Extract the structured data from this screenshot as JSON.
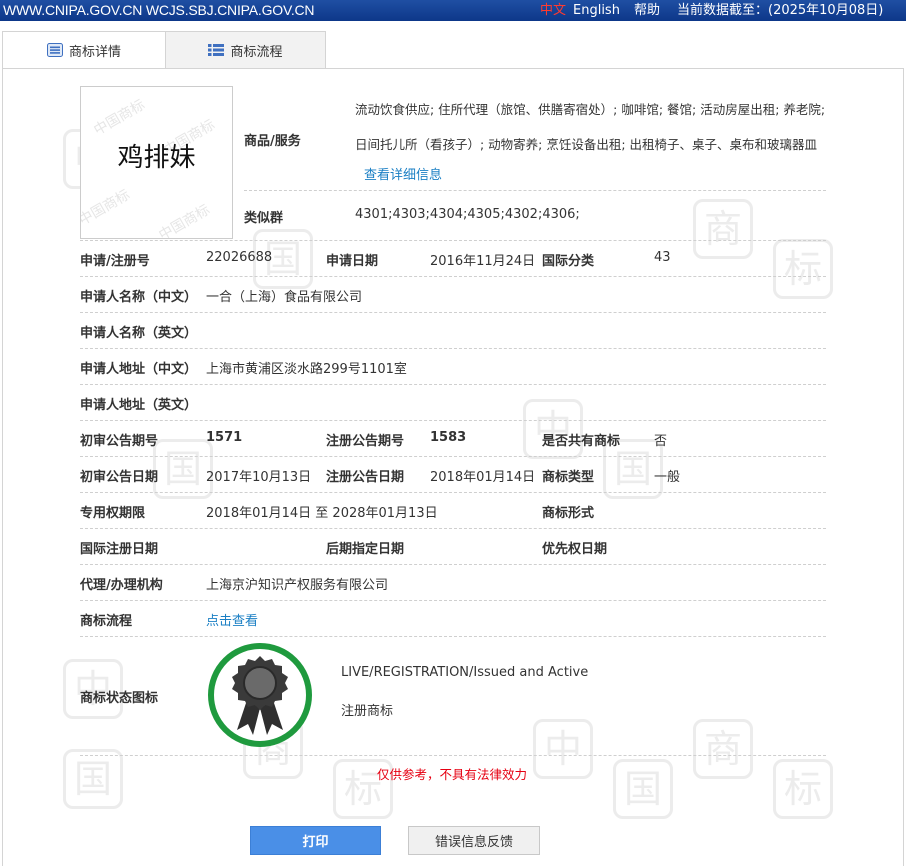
{
  "topbar": {
    "domains": "WWW.CNIPA.GOV.CN WCJS.SBJ.CNIPA.GOV.CN",
    "lang_zh": "中文",
    "lang_en": "English",
    "help": "帮助",
    "data_date": "当前数据截至：(2025年10月08日)"
  },
  "tabs": [
    {
      "label": "商标详情",
      "icon": "document-list-icon",
      "active": true
    },
    {
      "label": "商标流程",
      "icon": "list-icon",
      "active": false
    }
  ],
  "trademark": {
    "image_text": "鸡排妹",
    "image_watermark": "中国商标"
  },
  "goods": {
    "label": "商品/服务",
    "line1": "流动饮食供应; 住所代理（旅馆、供膳寄宿处）; 咖啡馆; 餐馆; 活动房屋出租; 养老院;",
    "line2": "日间托儿所（看孩子）; 动物寄养; 烹饪设备出租; 出租椅子、桌子、桌布和玻璃器皿",
    "more_link": "查看详细信息"
  },
  "similar_group": {
    "label": "类似群",
    "value": "4301;4303;4304;4305;4302;4306;"
  },
  "fields": {
    "reg_no_label": "申请/注册号",
    "reg_no": "22026688",
    "apply_date_label": "申请日期",
    "apply_date": "2016年11月24日",
    "intl_class_label": "国际分类",
    "intl_class": "43",
    "applicant_cn_label": "申请人名称（中文）",
    "applicant_cn": "一合（上海）食品有限公司",
    "applicant_en_label": "申请人名称（英文）",
    "applicant_en": "",
    "address_cn_label": "申请人地址（中文）",
    "address_cn": "上海市黄浦区淡水路299号1101室",
    "address_en_label": "申请人地址（英文）",
    "address_en": "",
    "prelim_issue_label": "初审公告期号",
    "prelim_issue": "1571",
    "reg_issue_label": "注册公告期号",
    "reg_issue": "1583",
    "shared_label": "是否共有商标",
    "shared": "否",
    "prelim_date_label": "初审公告日期",
    "prelim_date": "2017年10月13日",
    "reg_date_label": "注册公告日期",
    "reg_date": "2018年01月14日",
    "tm_type_label": "商标类型",
    "tm_type": "一般",
    "exclusive_label": "专用权期限",
    "exclusive": "2018年01月14日 至 2028年01月13日",
    "tm_form_label": "商标形式",
    "tm_form": "",
    "intl_reg_date_label": "国际注册日期",
    "later_date_label": "后期指定日期",
    "priority_date_label": "优先权日期",
    "agent_label": "代理/办理机构",
    "agent": "上海京沪知识产权服务有限公司",
    "flow_label": "商标流程",
    "flow_link": "点击查看",
    "status_label": "商标状态图标",
    "status_en": "LIVE/REGISTRATION/Issued and Active",
    "status_cn": "注册商标"
  },
  "status_icon": {
    "name": "registered-badge-icon",
    "ring_color": "#1f9a3e"
  },
  "disclaimer": "仅供参考，不具有法律效力",
  "buttons": {
    "print": "打印",
    "feedback": "错误信息反馈"
  },
  "colors": {
    "topbar": "#1f4fa3",
    "link": "#1a7fc4",
    "disclaimer": "#e60012",
    "print_button": "#4a8fe7"
  }
}
